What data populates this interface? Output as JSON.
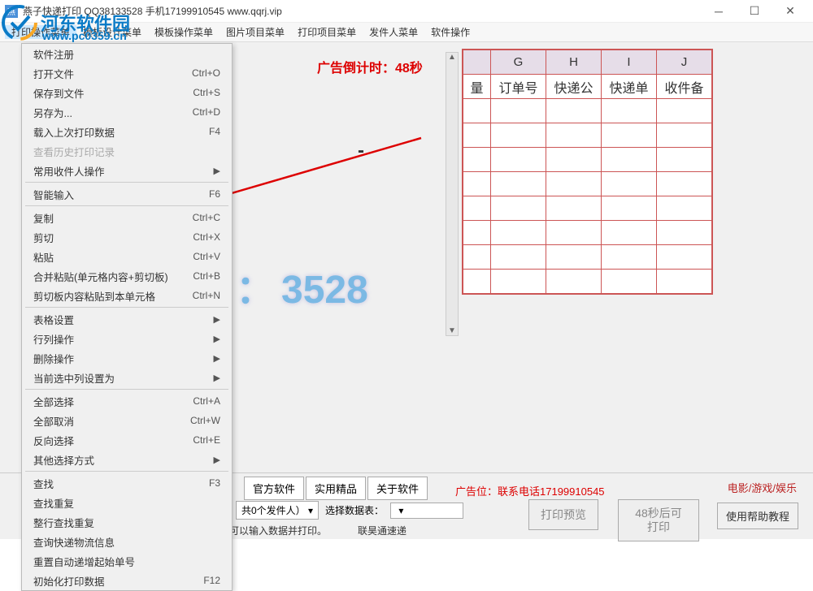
{
  "title": "燕子快递打印   QQ38133528  手机17199910545   www.qqrj.vip",
  "watermark": {
    "brand": "河东软件园",
    "url": "www.pc0359.cn"
  },
  "menubar": [
    "打印操作菜单",
    "模板设计菜单",
    "模板操作菜单",
    "图片项目菜单",
    "打印项目菜单",
    "发件人菜单",
    "软件操作"
  ],
  "dropdown": [
    {
      "label": "软件注册",
      "type": "item"
    },
    {
      "label": "打开文件",
      "shortcut": "Ctrl+O",
      "type": "item"
    },
    {
      "label": "保存到文件",
      "shortcut": "Ctrl+S",
      "type": "item"
    },
    {
      "label": "另存为...",
      "shortcut": "Ctrl+D",
      "type": "item"
    },
    {
      "label": "载入上次打印数据",
      "shortcut": "F4",
      "type": "item"
    },
    {
      "label": "查看历史打印记录",
      "type": "disabled"
    },
    {
      "label": "常用收件人操作",
      "type": "submenu"
    },
    {
      "type": "sep"
    },
    {
      "label": "智能输入",
      "shortcut": "F6",
      "type": "item"
    },
    {
      "type": "sep"
    },
    {
      "label": "复制",
      "shortcut": "Ctrl+C",
      "type": "item"
    },
    {
      "label": "剪切",
      "shortcut": "Ctrl+X",
      "type": "item"
    },
    {
      "label": "粘贴",
      "shortcut": "Ctrl+V",
      "type": "item"
    },
    {
      "label": "合并粘贴(单元格内容+剪切板)",
      "shortcut": "Ctrl+B",
      "type": "item"
    },
    {
      "label": "剪切板内容粘贴到本单元格",
      "shortcut": "Ctrl+N",
      "type": "item"
    },
    {
      "type": "sep"
    },
    {
      "label": "表格设置",
      "type": "submenu"
    },
    {
      "label": "行列操作",
      "type": "submenu"
    },
    {
      "label": "删除操作",
      "type": "submenu"
    },
    {
      "label": "当前选中列设置为",
      "type": "submenu"
    },
    {
      "type": "sep"
    },
    {
      "label": "全部选择",
      "shortcut": "Ctrl+A",
      "type": "item"
    },
    {
      "label": "全部取消",
      "shortcut": "Ctrl+W",
      "type": "item"
    },
    {
      "label": "反向选择",
      "shortcut": "Ctrl+E",
      "type": "item"
    },
    {
      "label": "其他选择方式",
      "type": "submenu"
    },
    {
      "type": "sep"
    },
    {
      "label": "查找",
      "shortcut": "F3",
      "type": "item"
    },
    {
      "label": "查找重复",
      "type": "item"
    },
    {
      "label": "整行查找重复",
      "type": "item"
    },
    {
      "label": "查询快递物流信息",
      "type": "item"
    },
    {
      "label": "重置自动递增起始单号",
      "type": "item"
    },
    {
      "label": "初始化打印数据",
      "shortcut": "F12",
      "type": "item"
    }
  ],
  "ad_countdown": "广告倒计时：48秒",
  "bg_number": "3528",
  "bg_colon": "：",
  "grid": {
    "cols": [
      "G",
      "H",
      "I",
      "J"
    ],
    "col_extra_left": "量",
    "headers": [
      "订单号",
      "快递公",
      "快递单",
      "收件备"
    ],
    "rows": 8
  },
  "footer": {
    "tabs": [
      "官方软件",
      "实用精品",
      "关于软件"
    ],
    "ad_label": "广告位：联系电话17199910545",
    "right_link": "电影/游戏/娱乐",
    "sender_text": "共0个发件人）",
    "select_table_label": "选择数据表：",
    "btn_preview": "打印预览",
    "btn_print": "48秒后可打印",
    "btn_help": "使用帮助教程",
    "bottom_text1": "可以输入数据并打印。",
    "bottom_text2": "联昊通速递"
  }
}
